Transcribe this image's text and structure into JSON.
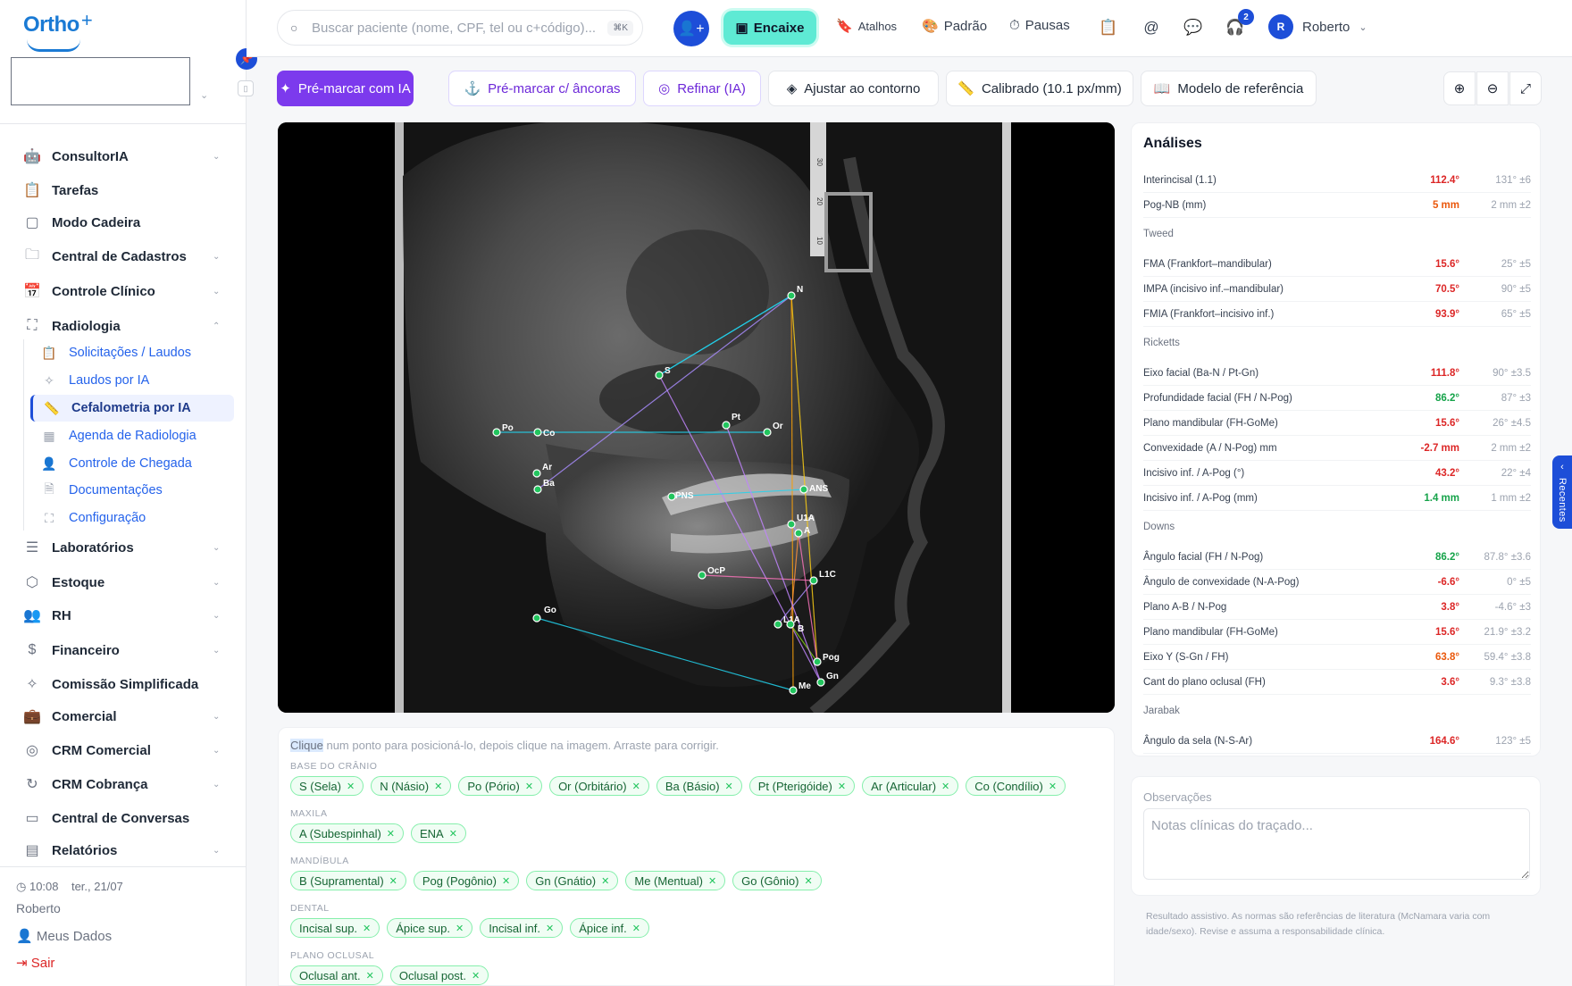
{
  "sidebar": {
    "logo": "Ortho",
    "logo_plus": "+",
    "items_top": [
      {
        "label": "ConsultorIA",
        "icon": "robot-icon",
        "chevron": true
      },
      {
        "label": "Tarefas",
        "icon": "clipboard-icon",
        "chevron": false
      },
      {
        "label": "Modo Cadeira",
        "icon": "square-icon",
        "chevron": false
      },
      {
        "label": "Central de Cadastros",
        "icon": "folder-icon",
        "chevron": true
      },
      {
        "label": "Controle Clínico",
        "icon": "calendar-icon",
        "chevron": true
      },
      {
        "label": "Radiologia",
        "icon": "scan-icon",
        "chevron": true
      }
    ],
    "radiologia_sub": [
      {
        "label": "Solicitações / Laudos",
        "icon": "clipboard-list-icon"
      },
      {
        "label": "Laudos por IA",
        "icon": "sparkles-icon"
      },
      {
        "label": "Cefalometria por IA",
        "icon": "ruler-icon",
        "active": true
      },
      {
        "label": "Agenda de Radiologia",
        "icon": "calendar-grid-icon"
      },
      {
        "label": "Controle de Chegada",
        "icon": "user-check-icon"
      },
      {
        "label": "Documentações",
        "icon": "file-icon"
      },
      {
        "label": "Configuração",
        "icon": "scan-settings-icon"
      }
    ],
    "items_bottom": [
      {
        "label": "Laboratórios",
        "icon": "layers-icon",
        "chevron": true
      },
      {
        "label": "Estoque",
        "icon": "box-icon",
        "chevron": true
      },
      {
        "label": "RH",
        "icon": "users-icon",
        "chevron": true
      },
      {
        "label": "Financeiro",
        "icon": "dollar-icon",
        "chevron": true
      },
      {
        "label": "Comissão Simplificada",
        "icon": "sparkles-icon",
        "chevron": false
      },
      {
        "label": "Comercial",
        "icon": "briefcase-icon",
        "chevron": true
      },
      {
        "label": "CRM Comercial",
        "icon": "target-icon",
        "chevron": true
      },
      {
        "label": "CRM Cobrança",
        "icon": "refresh-icon",
        "chevron": true
      },
      {
        "label": "Central de Conversas",
        "icon": "chat-icon",
        "chevron": false
      },
      {
        "label": "Relatórios",
        "icon": "chart-icon",
        "chevron": true
      }
    ],
    "footer": {
      "time": "10:08",
      "date": "ter., 21/07",
      "user": "Roberto",
      "meus_dados": "Meus Dados",
      "sair": "Sair"
    }
  },
  "topbar": {
    "search_placeholder": "Buscar paciente (nome, CPF, tel ou c+código)...",
    "search_kbd": "⌘K",
    "encaixe": "Encaixe",
    "atalhos": "Atalhos",
    "padrao": "Padrão",
    "pausas": "Pausas",
    "notif_count": "2",
    "user_initial": "R",
    "user_name": "Roberto"
  },
  "toolbar": {
    "premarcar_ia": "Pré-marcar com IA",
    "premarcar_ancoras": "Pré-marcar c/ âncoras",
    "refinar": "Refinar (IA)",
    "ajustar": "Ajustar ao contorno",
    "calibrado": "Calibrado (10.1 px/mm)",
    "modelo": "Modelo de referência"
  },
  "xray": {
    "landmark_labels": [
      "N",
      "S",
      "Po",
      "Co",
      "Pt",
      "Or",
      "Ar",
      "Ba",
      "PNS",
      "ANS",
      "U1A",
      "A",
      "OcP",
      "L1A",
      "Go",
      "B",
      "L1C",
      "Pog",
      "Gn",
      "Me"
    ],
    "ruler_ticks": [
      "30",
      "20",
      "10"
    ]
  },
  "landmarks": {
    "hint_hl": "Clique",
    "hint": " num ponto para posicioná-lo, depois clique na imagem. Arraste para corrigir.",
    "groups": [
      {
        "title": "BASE DO CRÂNIO",
        "chips": [
          "S (Sela)",
          "N (Násio)",
          "Po (Pório)",
          "Or (Orbitário)",
          "Ba (Básio)",
          "Pt (Pterigóide)",
          "Ar (Articular)",
          "Co (Condílio)"
        ]
      },
      {
        "title": "MAXILA",
        "chips": [
          "A (Subespinhal)",
          "ENA"
        ]
      },
      {
        "title": "MANDÍBULA",
        "chips": [
          "B (Supramental)",
          "Pog (Pogônio)",
          "Gn (Gnátio)",
          "Me (Mentual)",
          "Go (Gônio)"
        ]
      },
      {
        "title": "DENTAL",
        "chips": [
          "Incisal sup.",
          "Ápice sup.",
          "Incisal inf.",
          "Ápice inf."
        ]
      },
      {
        "title": "PLANO OCLUSAL",
        "chips": [
          "Oclusal ant.",
          "Oclusal post."
        ]
      }
    ]
  },
  "analyses": {
    "title": "Análises",
    "rows": [
      {
        "type": "row",
        "name": "Interincisal (1.1)",
        "value": "112.4°",
        "norm": "131° ±6",
        "color": "red"
      },
      {
        "type": "row",
        "name": "Pog-NB (mm)",
        "value": "5 mm",
        "norm": "2 mm ±2",
        "color": "org"
      },
      {
        "type": "sec",
        "name": "Tweed"
      },
      {
        "type": "row",
        "name": "FMA (Frankfort–mandibular)",
        "value": "15.6°",
        "norm": "25° ±5",
        "color": "red"
      },
      {
        "type": "row",
        "name": "IMPA (incisivo inf.–mandibular)",
        "value": "70.5°",
        "norm": "90° ±5",
        "color": "red"
      },
      {
        "type": "row",
        "name": "FMIA (Frankfort–incisivo inf.)",
        "value": "93.9°",
        "norm": "65° ±5",
        "color": "red"
      },
      {
        "type": "sec",
        "name": "Ricketts"
      },
      {
        "type": "row",
        "name": "Eixo facial (Ba-N / Pt-Gn)",
        "value": "111.8°",
        "norm": "90° ±3.5",
        "color": "red"
      },
      {
        "type": "row",
        "name": "Profundidade facial (FH / N-Pog)",
        "value": "86.2°",
        "norm": "87° ±3",
        "color": "grn"
      },
      {
        "type": "row",
        "name": "Plano mandibular (FH-GoMe)",
        "value": "15.6°",
        "norm": "26° ±4.5",
        "color": "red"
      },
      {
        "type": "row",
        "name": "Convexidade (A / N-Pog) mm",
        "value": "-2.7 mm",
        "norm": "2 mm ±2",
        "color": "red"
      },
      {
        "type": "row",
        "name": "Incisivo inf. / A-Pog (°)",
        "value": "43.2°",
        "norm": "22° ±4",
        "color": "red"
      },
      {
        "type": "row",
        "name": "Incisivo inf. / A-Pog (mm)",
        "value": "1.4 mm",
        "norm": "1 mm ±2",
        "color": "grn"
      },
      {
        "type": "sec",
        "name": "Downs"
      },
      {
        "type": "row",
        "name": "Ângulo facial (FH / N-Pog)",
        "value": "86.2°",
        "norm": "87.8° ±3.6",
        "color": "grn"
      },
      {
        "type": "row",
        "name": "Ângulo de convexidade (N-A-Pog)",
        "value": "-6.6°",
        "norm": "0° ±5",
        "color": "red"
      },
      {
        "type": "row",
        "name": "Plano A-B / N-Pog",
        "value": "3.8°",
        "norm": "-4.6° ±3",
        "color": "red"
      },
      {
        "type": "row",
        "name": "Plano mandibular (FH-GoMe)",
        "value": "15.6°",
        "norm": "21.9° ±3.2",
        "color": "red"
      },
      {
        "type": "row",
        "name": "Eixo Y (S-Gn / FH)",
        "value": "63.8°",
        "norm": "59.4° ±3.8",
        "color": "org"
      },
      {
        "type": "row",
        "name": "Cant do plano oclusal (FH)",
        "value": "3.6°",
        "norm": "9.3° ±3.8",
        "color": "red"
      },
      {
        "type": "sec",
        "name": "Jarabak"
      },
      {
        "type": "row",
        "name": "Ângulo da sela (N-S-Ar)",
        "value": "164.6°",
        "norm": "123° ±5",
        "color": "red"
      }
    ]
  },
  "observacoes": {
    "title": "Observações",
    "placeholder": "Notas clínicas do traçado..."
  },
  "disclaimer": "Resultado assistivo. As normas são referências de literatura (McNamara varia com idade/sexo). Revise e assuma a responsabilidade clínica.",
  "recentes": "Recentes"
}
